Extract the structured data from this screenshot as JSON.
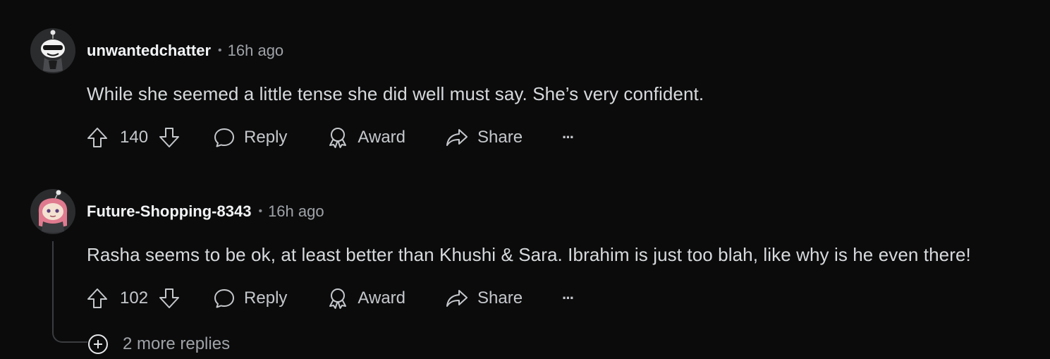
{
  "comments": [
    {
      "username": "unwantedchatter",
      "separator": "•",
      "time": "16h ago",
      "text": "While she seemed a little tense she did well must say. She’s very confident.",
      "votes": "140",
      "reply_label": "Reply",
      "award_label": "Award",
      "share_label": "Share",
      "more_label": "···"
    },
    {
      "username": "Future-Shopping-8343",
      "separator": "•",
      "time": "16h ago",
      "text": "Rasha seems to be ok, at least better than Khushi & Sara. Ibrahim is just too blah, like why is he even there!",
      "votes": "102",
      "reply_label": "Reply",
      "award_label": "Award",
      "share_label": "Share",
      "more_label": "···"
    }
  ],
  "more_replies": {
    "label": "2 more replies"
  },
  "colors": {
    "background": "#0b0b0c",
    "text": "#d7dadc",
    "muted": "#9fa3a7",
    "thread_line": "#3a3c3f"
  }
}
